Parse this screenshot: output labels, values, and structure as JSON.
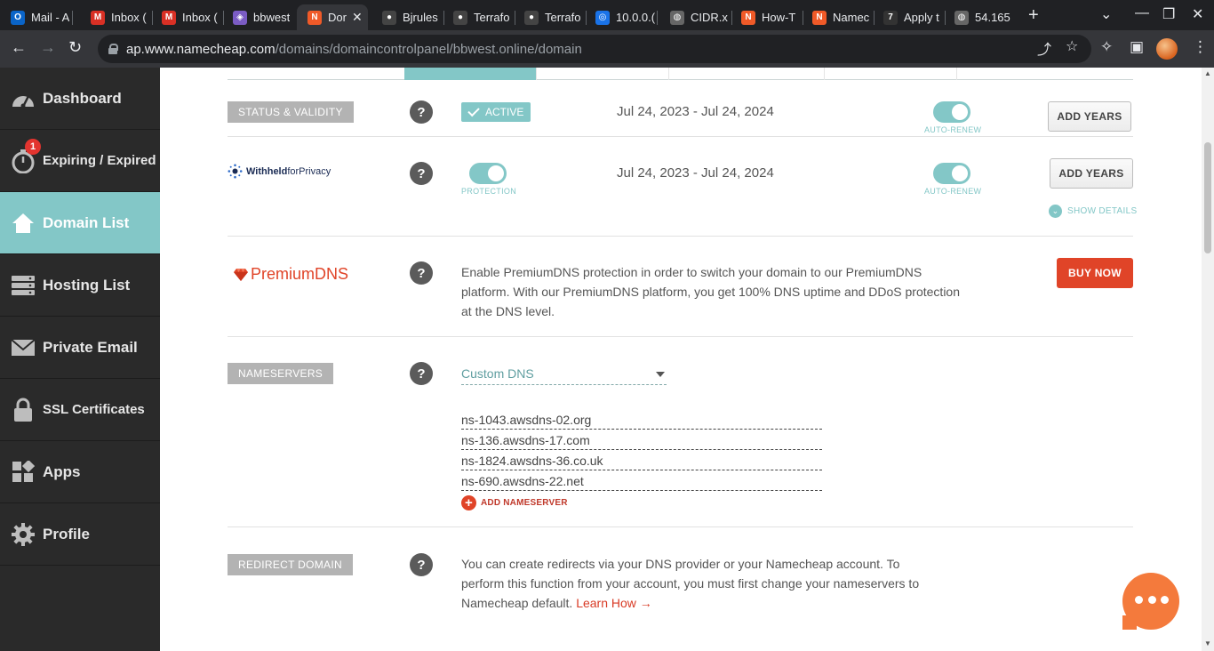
{
  "browser": {
    "tabs": [
      {
        "title": "Mail - A",
        "icon": "outlook-icon",
        "color": "#0a64c8"
      },
      {
        "title": "Inbox (",
        "icon": "gmail-icon",
        "color": "#d93025"
      },
      {
        "title": "Inbox (",
        "icon": "gmail-icon",
        "color": "#d93025"
      },
      {
        "title": "bbwest",
        "icon": "shield-app-icon",
        "color": "#7b5cc4"
      },
      {
        "title": "Dor",
        "icon": "namecheap-icon",
        "color": "#f05a28",
        "active": true
      },
      {
        "title": "Bjrules",
        "icon": "github-icon",
        "color": "#444"
      },
      {
        "title": "Terrafo",
        "icon": "github-icon",
        "color": "#444"
      },
      {
        "title": "Terrafo",
        "icon": "github-icon",
        "color": "#444"
      },
      {
        "title": "10.0.0.(",
        "icon": "location-icon",
        "color": "#1a73e8"
      },
      {
        "title": "CIDR.x",
        "icon": "globe-icon",
        "color": "#666"
      },
      {
        "title": "How-T",
        "icon": "namecheap-icon",
        "color": "#f05a28"
      },
      {
        "title": "Namec",
        "icon": "namecheap-icon",
        "color": "#f05a28"
      },
      {
        "title": "Apply t",
        "icon": "zapier-icon",
        "color": "#333"
      },
      {
        "title": "54.165",
        "icon": "globe-icon",
        "color": "#666"
      }
    ],
    "url_host": "ap.www.namecheap.com",
    "url_path": "/domains/domaincontrolpanel/bbwest.online/domain"
  },
  "sidebar": {
    "items": [
      {
        "label": "Dashboard",
        "icon": "speedometer-icon"
      },
      {
        "label": "Expiring / Expired",
        "icon": "timer-icon",
        "badge": "1"
      },
      {
        "label": "Domain List",
        "icon": "home-icon",
        "active": true
      },
      {
        "label": "Hosting List",
        "icon": "server-icon"
      },
      {
        "label": "Private Email",
        "icon": "envelope-icon"
      },
      {
        "label": "SSL Certificates",
        "icon": "lock-icon"
      },
      {
        "label": "Apps",
        "icon": "apps-icon"
      },
      {
        "label": "Profile",
        "icon": "gear-icon"
      }
    ]
  },
  "status": {
    "label": "STATUS & VALIDITY",
    "badge": "ACTIVE",
    "dates": "Jul 24, 2023 - Jul 24, 2024",
    "autorenew_label": "AUTO-RENEW",
    "add_years": "ADD YEARS"
  },
  "privacy": {
    "logo_bold": "Withheld",
    "logo_light": "forPrivacy",
    "protection_label": "PROTECTION",
    "dates": "Jul 24, 2023 - Jul 24, 2024",
    "autorenew_label": "AUTO-RENEW",
    "add_years": "ADD YEARS",
    "show_details": "SHOW DETAILS"
  },
  "premiumdns": {
    "logo": "PremiumDNS",
    "line1": "Enable PremiumDNS protection in order to switch your domain to our PremiumDNS",
    "line2": "platform. With our PremiumDNS platform, you get 100% DNS uptime and DDoS protection",
    "line3": "at the DNS level.",
    "buy_now": "BUY NOW"
  },
  "nameservers": {
    "label": "NAMESERVERS",
    "selected": "Custom DNS",
    "entries": [
      "ns-1043.awsdns-02.org",
      "ns-136.awsdns-17.com",
      "ns-1824.awsdns-36.co.uk",
      "ns-690.awsdns-22.net"
    ],
    "add_label": "ADD NAMESERVER"
  },
  "redirect": {
    "label": "REDIRECT DOMAIN",
    "line1": "You can create redirects via your DNS provider or your Namecheap account. To",
    "line2": "perform this function from your account, you must first change your nameservers to",
    "line3": "Namecheap default.",
    "link": "Learn How →"
  },
  "help_glyph": "?",
  "colors": {
    "accent": "#83c7c7",
    "brand_orange": "#f05a28",
    "buy_red": "#e04428"
  }
}
